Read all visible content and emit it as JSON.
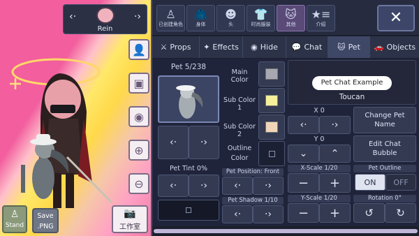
{
  "character": {
    "name": "Rein"
  },
  "stage": {
    "stand_label": "Stand",
    "save_label": "Save\n.PNG",
    "studio_label": "工作室"
  },
  "top_tabs": [
    {
      "label": "已创建角色",
      "icon": "character-icon"
    },
    {
      "label": "身体",
      "icon": "jacket-icon"
    },
    {
      "label": "头",
      "icon": "hair-icon"
    },
    {
      "label": "时尚服装",
      "icon": "shirt-icon"
    },
    {
      "label": "其他",
      "icon": "cat-brush-icon"
    },
    {
      "label": "介绍",
      "icon": "star-list-icon"
    }
  ],
  "sub_tabs": {
    "props": "Props",
    "effects": "Effects",
    "hide": "Hide",
    "chat": "Chat",
    "pet": "Pet",
    "objects": "Objects"
  },
  "pet": {
    "counter": "Pet 5/238",
    "tint": "Pet Tint 0%",
    "position": "Pet Position: Front",
    "shadow": "Pet Shadow 1/10",
    "chat_example": "Pet Chat Example",
    "name": "Toucan"
  },
  "colors": {
    "main_label": "Main Color",
    "sub1_label": "Sub Color 1",
    "sub2_label": "Sub Color 2",
    "outline_label": "Outline\nColor",
    "main": "#a8a9b0",
    "sub1": "#f7ef9a",
    "sub2": "#f1d5b9",
    "outline": "#2a2e40"
  },
  "controls": {
    "x0": "X 0",
    "y0": "Y 0",
    "xscale": "X-Scale 1/20",
    "yscale": "Y-Scale 1/20",
    "change_name": "Change Pet\nName",
    "edit_chat": "Edit Chat\nBubble",
    "outline": "Pet Outline",
    "on": "ON",
    "off": "OFF",
    "rotation": "Rotation 0°"
  }
}
